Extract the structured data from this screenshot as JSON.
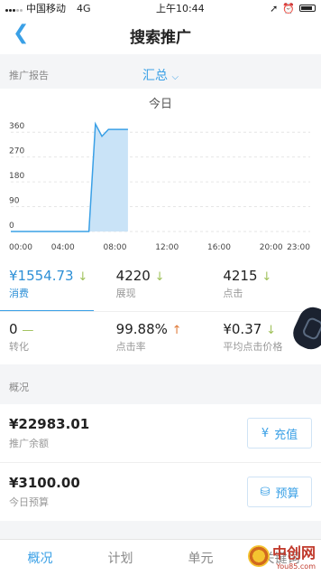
{
  "status_bar": {
    "carrier": "中国移动",
    "network": "4G",
    "time": "上午10:44"
  },
  "header": {
    "title": "搜索推广",
    "back_icon": "chevron-left-icon"
  },
  "report": {
    "label": "推广报告",
    "selector": "汇总"
  },
  "chart": {
    "period_label": "今日"
  },
  "chart_data": {
    "type": "area",
    "x": [
      "00:00",
      "01:00",
      "02:00",
      "03:00",
      "04:00",
      "05:00",
      "06:00",
      "06:30",
      "07:00",
      "07:30",
      "08:00",
      "08:30",
      "09:00"
    ],
    "values": [
      0,
      0,
      0,
      0,
      0,
      0,
      0,
      390,
      345,
      370,
      370,
      370,
      370
    ],
    "xticks": [
      "00:00",
      "04:00",
      "08:00",
      "12:00",
      "16:00",
      "20:00",
      "23:00"
    ],
    "yticks": [
      "0",
      "90",
      "180",
      "270",
      "360"
    ],
    "ylim": [
      0,
      400
    ],
    "xlim": [
      "00:00",
      "23:00"
    ],
    "grid": true,
    "title": "今日"
  },
  "metrics": [
    {
      "value": "¥1554.73",
      "label": "消费",
      "trend": "↓"
    },
    {
      "value": "4220",
      "label": "展现",
      "trend": "↓"
    },
    {
      "value": "4215",
      "label": "点击",
      "trend": "↓"
    },
    {
      "value": "0",
      "label": "转化",
      "trend": "—"
    },
    {
      "value": "99.88%",
      "label": "点击率",
      "trend": "↑"
    },
    {
      "value": "¥0.37",
      "label": "平均点击价格",
      "trend": "↓"
    }
  ],
  "overview": {
    "label": "概况",
    "balance": {
      "value": "¥22983.01",
      "label": "推广余额",
      "button": "充值",
      "button_icon": "yen-icon"
    },
    "budget": {
      "value": "¥3100.00",
      "label": "今日预算",
      "button": "预算",
      "button_icon": "database-icon"
    }
  },
  "tabs": [
    "概况",
    "计划",
    "单元",
    "关键词"
  ],
  "watermark": {
    "text": "中创网",
    "sub": "You85.com"
  },
  "colors": {
    "accent": "#3aa0e6",
    "area_fill": "#c9e3f7",
    "trend_down": "#9fc15a",
    "trend_up": "#e07b3a"
  }
}
